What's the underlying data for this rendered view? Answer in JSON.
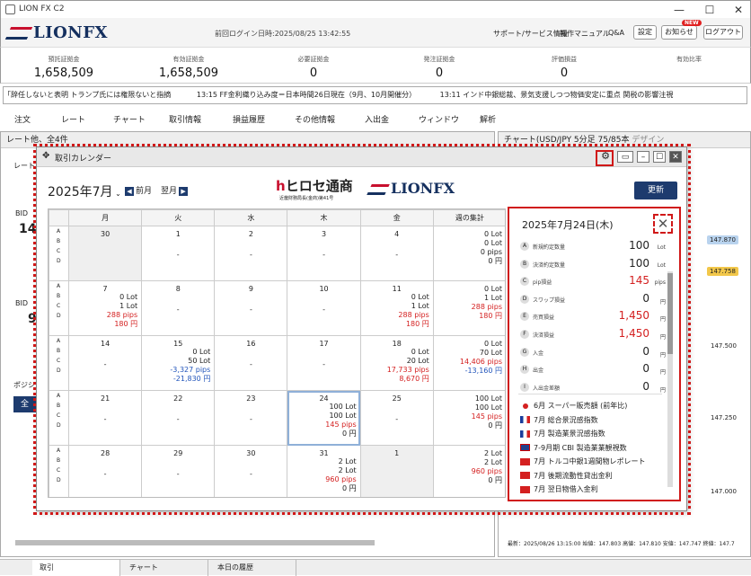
{
  "app": {
    "title": "LION FX C2",
    "logo": "LIONFX",
    "last_login": "前回ログイン日時:2025/08/25 13:42:55"
  },
  "header": {
    "links": [
      "サポート/サービス情報",
      "操作マニュアル",
      "Q&A"
    ],
    "buttons": [
      "設定",
      "お知らせ",
      "ログアウト"
    ],
    "badge": "NEW"
  },
  "summary": [
    {
      "label": "預託証拠金",
      "value": "1,658,509"
    },
    {
      "label": "有効証拠金",
      "value": "1,658,509"
    },
    {
      "label": "必要証拠金",
      "value": "0"
    },
    {
      "label": "発注証拠金",
      "value": "0"
    },
    {
      "label": "評価損益",
      "value": "0"
    },
    {
      "label": "有効比率",
      "value": ""
    }
  ],
  "ticker": {
    "item1": "「辞任しないと表明 トランプ氏には権限ないと指摘",
    "item2": "13:15  FF金利織り込み度＝日本時間26日現在（9月、10月開催分）",
    "item3": "13:11  インド中銀総裁、景気支援しつつ物価安定に重点  関税の影響注視"
  },
  "menu": [
    "注文",
    "レート",
    "チャート",
    "取引情報",
    "損益履歴",
    "その他情報",
    "入出金",
    "ウィンドウ",
    "解析"
  ],
  "left_panel": {
    "title": "レート他、全4件",
    "tab": "レート",
    "bid_label": "BID",
    "bid1": "14",
    "bid2": "9",
    "position_label": "ポジショ",
    "all_button": "全"
  },
  "right_panel": {
    "title": "チャート(USD/JPY 5分足 75/85本",
    "design": "デザイン",
    "price1": "147.870",
    "price2": "147.758",
    "ticks": [
      "147.500",
      "147.250",
      "147.000"
    ],
    "footer": "最新：2025/08/26 13:15:00 始値：147.803 高値：147.810 安値：147.747 終値：147.7"
  },
  "bottom_tabs": [
    "取引",
    "チャート",
    "本日の履歴"
  ],
  "calendar": {
    "window_title": "取引カレンダー",
    "month": "2025年7月",
    "prev": "前月",
    "next": "翌月",
    "broker": "ヒロセ通商",
    "broker_sub": "近畿財務局長(金商)第41号",
    "logo": "LIONFX",
    "refresh": "更新",
    "weekdays": [
      "月",
      "火",
      "水",
      "木",
      "金",
      "週の集計"
    ],
    "row_labels": [
      "A",
      "B",
      "C",
      "D"
    ],
    "weeks": [
      [
        {
          "d": "30",
          "gray": true,
          "v": []
        },
        {
          "d": "1",
          "v": [
            "-"
          ]
        },
        {
          "d": "2",
          "v": [
            "-"
          ]
        },
        {
          "d": "3",
          "v": [
            "-"
          ]
        },
        {
          "d": "4",
          "v": [
            "-"
          ]
        },
        {
          "d": "",
          "v": [
            "0 Lot",
            "0 Lot",
            "0 pips",
            "0 円"
          ]
        }
      ],
      [
        {
          "d": "7",
          "v": [
            "0 Lot",
            "1 Lot",
            "288 pips",
            "180 円"
          ],
          "red": [
            2,
            3
          ]
        },
        {
          "d": "8",
          "v": [
            "-"
          ]
        },
        {
          "d": "9",
          "v": [
            "-"
          ]
        },
        {
          "d": "10",
          "v": [
            "-"
          ]
        },
        {
          "d": "11",
          "v": [
            "0 Lot",
            "1 Lot",
            "288 pips",
            "180 円"
          ],
          "red": [
            2,
            3
          ]
        },
        {
          "d": "",
          "v": [
            "0 Lot",
            "1 Lot",
            "288 pips",
            "180 円"
          ],
          "red": [
            2,
            3
          ]
        }
      ],
      [
        {
          "d": "14",
          "v": [
            "-"
          ]
        },
        {
          "d": "15",
          "v": [
            "0 Lot",
            "50 Lot",
            "-3,327 pips",
            "-21,830 円"
          ],
          "blue": [
            2,
            3
          ]
        },
        {
          "d": "16",
          "v": [
            "-"
          ]
        },
        {
          "d": "17",
          "v": [
            "-"
          ]
        },
        {
          "d": "18",
          "v": [
            "0 Lot",
            "20 Lot",
            "17,733 pips",
            "8,670 円"
          ],
          "red": [
            2,
            3
          ]
        },
        {
          "d": "",
          "v": [
            "0 Lot",
            "70 Lot",
            "14,406 pips",
            "-13,160 円"
          ],
          "red": [
            2
          ],
          "blue": [
            3
          ]
        }
      ],
      [
        {
          "d": "21",
          "v": [
            "-"
          ]
        },
        {
          "d": "22",
          "v": [
            "-"
          ]
        },
        {
          "d": "23",
          "v": [
            "-"
          ]
        },
        {
          "d": "24",
          "sel": true,
          "v": [
            "100 Lot",
            "100 Lot",
            "145 pips",
            "0 円"
          ],
          "red": [
            2
          ]
        },
        {
          "d": "25",
          "v": [
            "-"
          ]
        },
        {
          "d": "",
          "v": [
            "100 Lot",
            "100 Lot",
            "145 pips",
            "0 円"
          ],
          "red": [
            2
          ]
        }
      ],
      [
        {
          "d": "28",
          "v": [
            "-"
          ]
        },
        {
          "d": "29",
          "v": [
            "-"
          ]
        },
        {
          "d": "30",
          "v": [
            "-"
          ]
        },
        {
          "d": "31",
          "v": [
            "2 Lot",
            "2 Lot",
            "960 pips",
            "0 円"
          ],
          "red": [
            2
          ]
        },
        {
          "d": "1",
          "gray": true,
          "v": []
        },
        {
          "d": "",
          "v": [
            "2 Lot",
            "2 Lot",
            "960 pips",
            "0 円"
          ],
          "red": [
            2
          ]
        }
      ]
    ]
  },
  "detail": {
    "date": "2025年7月24日(木)",
    "close": "✕",
    "rows": [
      {
        "code": "A",
        "label": "新規約定数量",
        "value": "100",
        "unit": "Lot"
      },
      {
        "code": "B",
        "label": "決済約定数量",
        "value": "100",
        "unit": "Lot"
      },
      {
        "code": "C",
        "label": "pip損益",
        "value": "145",
        "unit": "pips",
        "red": true
      },
      {
        "code": "D",
        "label": "スワップ損益",
        "value": "0",
        "unit": "円"
      },
      {
        "code": "E",
        "label": "売買損益",
        "value": "1,450",
        "unit": "円",
        "red": true
      },
      {
        "code": "F",
        "label": "決済損益",
        "value": "1,450",
        "unit": "円",
        "red": true
      },
      {
        "code": "G",
        "label": "入金",
        "value": "0",
        "unit": "円"
      },
      {
        "code": "H",
        "label": "出金",
        "value": "0",
        "unit": "円"
      },
      {
        "code": "I",
        "label": "入出金差額",
        "value": "0",
        "unit": "円"
      }
    ],
    "events": [
      {
        "flag": "jp",
        "text": "6月 スーパー販売額 (前年比)"
      },
      {
        "flag": "fr",
        "text": "7月 総合景況感指数"
      },
      {
        "flag": "fr",
        "text": "7月 製造業景況感指数"
      },
      {
        "flag": "gb",
        "text": "7-9月期 CBI 製造業業観視数"
      },
      {
        "flag": "tr",
        "text": "7月 トルコ中銀1週間物レポレート"
      },
      {
        "flag": "tr",
        "text": "7月 後期流動性貸出金利"
      },
      {
        "flag": "tr",
        "text": "7月 翌日物借入金利"
      }
    ]
  },
  "colors": {
    "accent": "#1d3b6e",
    "highlight": "#d01818",
    "profit": "#d42020",
    "loss": "#2255bb"
  }
}
